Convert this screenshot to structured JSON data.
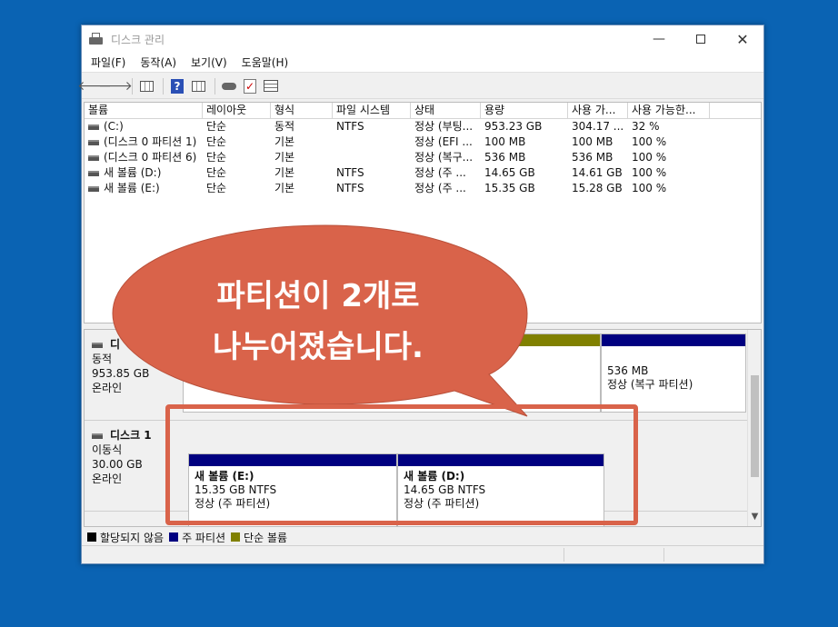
{
  "window": {
    "title": "디스크 관리",
    "controls": {
      "minimize": "—",
      "close": "✕"
    }
  },
  "menu": [
    "파일(F)",
    "동작(A)",
    "보기(V)",
    "도움말(H)"
  ],
  "toolbar": {
    "back": "🡐",
    "forward": "🡒"
  },
  "volumes": {
    "columns": [
      "볼륨",
      "레이아웃",
      "형식",
      "파일 시스템",
      "상태",
      "용량",
      "사용 가...",
      "사용 가능한..."
    ],
    "rows": [
      [
        "(C:)",
        "단순",
        "동적",
        "NTFS",
        "정상 (부팅...",
        "953.23 GB",
        "304.17 ...",
        "32 %"
      ],
      [
        "(디스크 0 파티션 1)",
        "단순",
        "기본",
        "",
        "정상 (EFI ...",
        "100 MB",
        "100 MB",
        "100 %"
      ],
      [
        "(디스크 0 파티션 6)",
        "단순",
        "기본",
        "",
        "정상 (복구...",
        "536 MB",
        "536 MB",
        "100 %"
      ],
      [
        "새 볼륨 (D:)",
        "단순",
        "기본",
        "NTFS",
        "정상 (주 ...",
        "14.65 GB",
        "14.61 GB",
        "100 %"
      ],
      [
        "새 볼륨 (E:)",
        "단순",
        "기본",
        "NTFS",
        "정상 (주 ...",
        "15.35 GB",
        "15.28 GB",
        "100 %"
      ]
    ]
  },
  "disks": {
    "disk0": {
      "name": "디",
      "type": "동적",
      "size": "953.85 GB",
      "status": "온라인",
      "recovery_partition": {
        "size": "536 MB",
        "status": "정상 (복구 파티션)"
      }
    },
    "disk1": {
      "name": "디스크 1",
      "type": "이동식",
      "size": "30.00 GB",
      "status": "온라인",
      "partitions": [
        {
          "title": "새 볼륨 (E:)",
          "size": "15.35 GB NTFS",
          "status": "정상 (주 파티션)"
        },
        {
          "title": "새 볼륨 (D:)",
          "size": "14.65 GB NTFS",
          "status": "정상 (주 파티션)"
        }
      ]
    }
  },
  "legend": [
    {
      "label": "할당되지 않음",
      "color": "#000000"
    },
    {
      "label": "주 파티션",
      "color": "#000080"
    },
    {
      "label": "단순 볼륨",
      "color": "#808000"
    }
  ],
  "callout": {
    "line1": "파티션이 2개로",
    "line2": "나누어졌습니다.",
    "color": "#d9634a"
  },
  "colors": {
    "desktop": "#0a63b3",
    "primary_partition": "#000080",
    "simple_volume": "#808000"
  }
}
